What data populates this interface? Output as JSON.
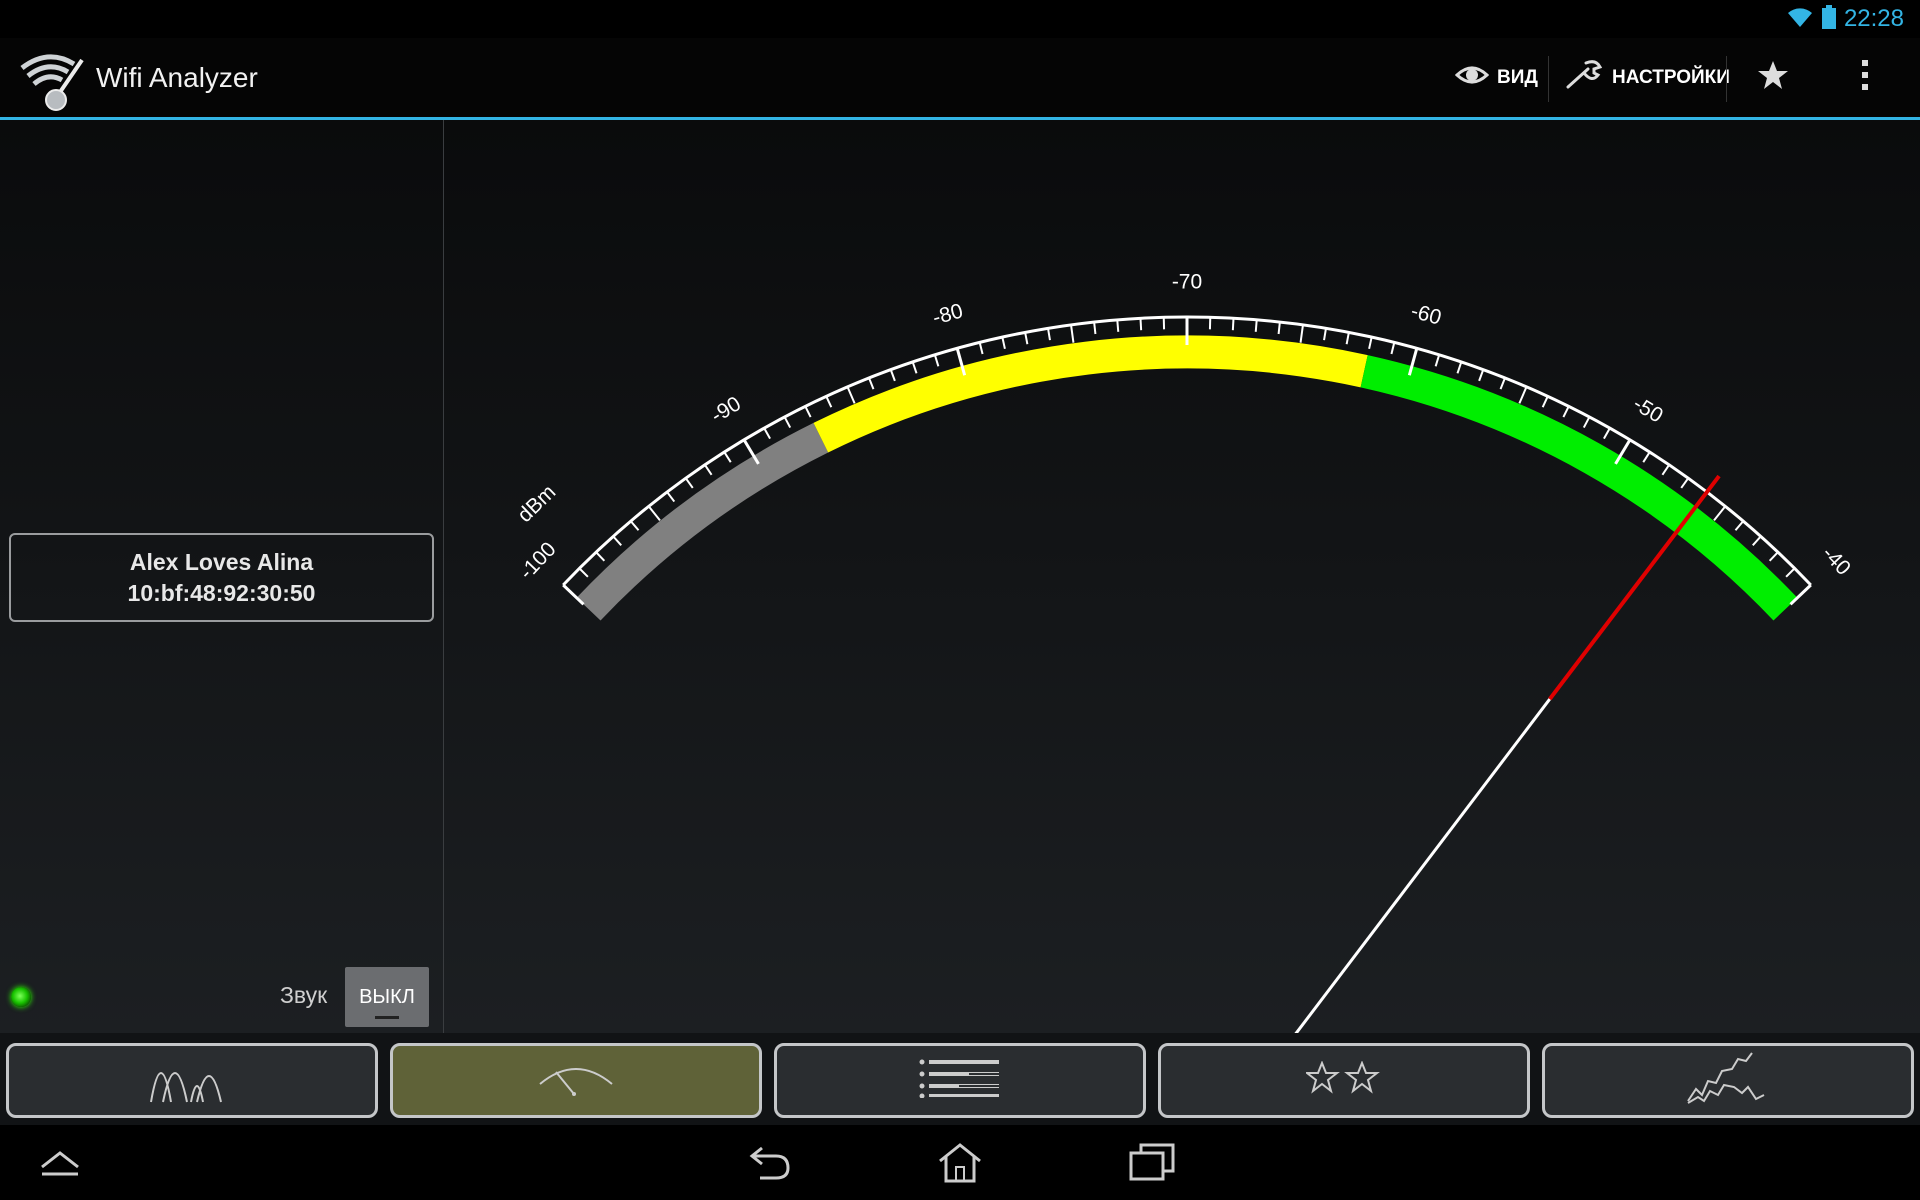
{
  "status_bar": {
    "time": "22:28",
    "icons": [
      "wifi-signal-icon",
      "battery-icon"
    ]
  },
  "action_bar": {
    "app_title": "Wifi Analyzer",
    "view_label": "ВИД",
    "settings_label": "НАСТРОЙКИ",
    "icons": [
      "wifi-analyzer-logo-icon",
      "eye-icon",
      "wrench-icon",
      "star-icon",
      "overflow-menu-icon"
    ]
  },
  "accent_color": "#33b5e5",
  "access_point": {
    "ssid": "Alex Loves Alina",
    "bssid": "10:bf:48:92:30:50"
  },
  "sound": {
    "label": "Звук",
    "toggle": "ВЫКЛ"
  },
  "meter": {
    "unit": "dBm",
    "min": -100,
    "max": -40,
    "major_ticks": [
      "-100",
      "-90",
      "-80",
      "-70",
      "-60",
      "-50",
      "-40"
    ],
    "zones": [
      {
        "from": -100,
        "to": -87,
        "color": "#808080"
      },
      {
        "from": -87,
        "to": -62,
        "color": "#ffff00"
      },
      {
        "from": -62,
        "to": -40,
        "color": "#00ee00"
      }
    ],
    "needle_value": -46,
    "needle_colors": {
      "outer": "#e00000",
      "inner": "#ffffff"
    }
  },
  "tabs": [
    {
      "name": "channel-graph",
      "active": false
    },
    {
      "name": "signal-meter",
      "active": true
    },
    {
      "name": "ap-list",
      "active": false
    },
    {
      "name": "channel-rating",
      "active": false
    },
    {
      "name": "time-graph",
      "active": false
    }
  ],
  "nav_bar": {
    "icons": [
      "collapse-icon",
      "back-icon",
      "home-icon",
      "recent-apps-icon"
    ]
  }
}
